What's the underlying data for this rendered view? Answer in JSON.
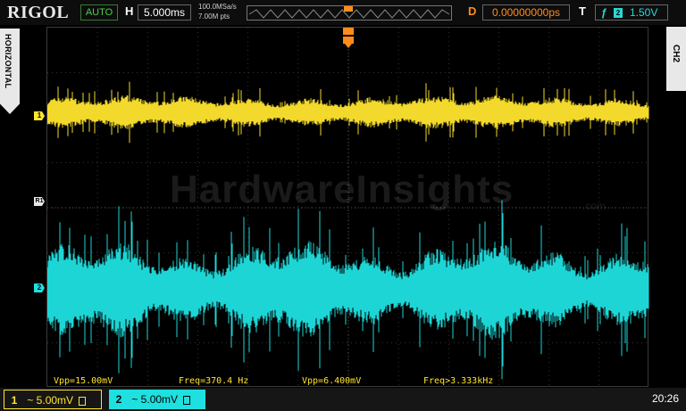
{
  "brand": "RIGOL",
  "acquisition_mode": "AUTO",
  "horizontal": {
    "label": "H",
    "timebase": "5.000ms",
    "sample_rate": "100.0MSa/s",
    "memory_depth": "7.00M pts"
  },
  "delay": {
    "label": "D",
    "value": "0.00000000ps"
  },
  "trigger": {
    "label": "T",
    "slope_symbol": "ƒ",
    "channel": "2",
    "level": "1.50V"
  },
  "left_tab": "HORIZONTAL",
  "right_tab": "CH2",
  "markers": {
    "ch1": "1",
    "ref": "R1",
    "ch2": "2"
  },
  "measurements": [
    {
      "text": "Vpp=15.00mV"
    },
    {
      "text": "Freq=370.4 Hz"
    },
    {
      "text": "Vpp=6.400mV"
    },
    {
      "text": "Freq>3.333kHz"
    }
  ],
  "channels": [
    {
      "num": "1",
      "scale": "~ 5.00mV",
      "color": "#ffe52d"
    },
    {
      "num": "2",
      "scale": "~ 5.00mV",
      "color": "#1fe0e0"
    }
  ],
  "clock": "20:26",
  "watermark": {
    "title": "HardwareInsights",
    "suffix": ".com"
  },
  "colors": {
    "ch1": "#ffe52d",
    "ch2": "#1fe0e0",
    "trigger": "#ff8c1a",
    "acquisition": "#4cd04c"
  }
}
